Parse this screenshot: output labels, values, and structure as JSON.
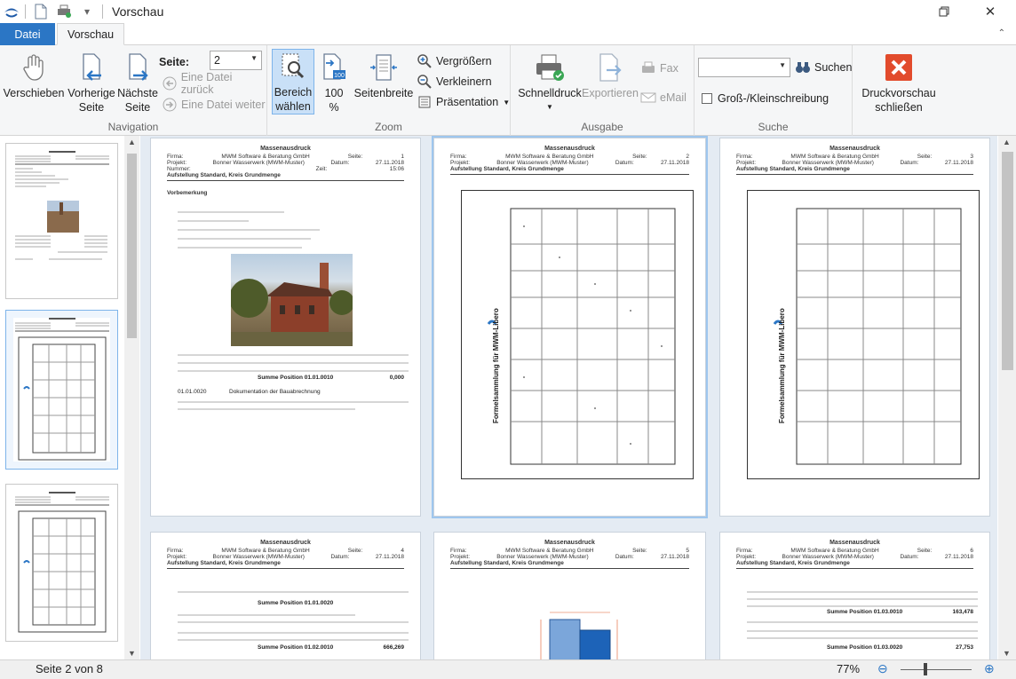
{
  "window": {
    "title": "Vorschau"
  },
  "tabs": {
    "file": "Datei",
    "preview": "Vorschau"
  },
  "ribbon": {
    "navigation": {
      "label": "Navigation",
      "move": "Verschieben",
      "prev_line1": "Vorherige",
      "prev_line2": "Seite",
      "next_line1": "Nächste",
      "next_line2": "Seite",
      "page_label": "Seite:",
      "page_value": "2",
      "file_back": "Eine Datei zurück",
      "file_forward": "Eine Datei weiter"
    },
    "zoom": {
      "label": "Zoom",
      "area_line1": "Bereich",
      "area_line2": "wählen",
      "hundred_line1": "100",
      "hundred_line2": "%",
      "page_width": "Seitenbreite",
      "enlarge": "Vergrößern",
      "shrink": "Verkleinern",
      "presentation": "Präsentation"
    },
    "output": {
      "label": "Ausgabe",
      "quick_print": "Schnelldruck",
      "export": "Exportieren",
      "fax": "Fax",
      "email": "eMail"
    },
    "search": {
      "label": "Suche",
      "search_value": "",
      "search_button": "Suchen",
      "case_sensitive": "Groß-/Kleinschreibung"
    },
    "close": {
      "line1": "Druckvorschau",
      "line2": "schließen"
    }
  },
  "pages": {
    "doc_title": "Massenausdruck",
    "firm_label": "Firma:",
    "firm": "MWM Software & Beratung GmbH",
    "project_label": "Projekt:",
    "project": "Bonner Wasserwerk (MWM-Muster)",
    "number_label": "Nummer:",
    "page_label": "Seite:",
    "date_label": "Datum:",
    "date": "27.11.2018",
    "time_label": "Zeit:",
    "time": "15:06",
    "subtitle": "Aufstellung Standard, Kreis Grundmenge",
    "side_text": "Formelsammlung für MWM-Libero",
    "p1_vorbemerkung": "Vorbemerkung",
    "p1_sum": "Summe Position 01.01.0010",
    "p1_sum_value": "0,000",
    "p1_pos2": "01.01.0020",
    "p1_pos2_text": "Dokumentation der Bauabrechnung",
    "p4_sum": "Summe Position 01.01.0020",
    "p4_sum2": "Summe Position 01.02.0010",
    "p4_sum2_value": "666,269",
    "p6_sum": "Summe Position 01.03.0010",
    "p6_sum_value": "163,478",
    "p6_sum2": "Summe Position 01.03.0020",
    "p6_sum2_value": "27,753",
    "numbers": [
      "1",
      "2",
      "3",
      "4",
      "5",
      "6"
    ]
  },
  "status": {
    "page": "Seite 2 von 8",
    "zoom": "77%"
  }
}
